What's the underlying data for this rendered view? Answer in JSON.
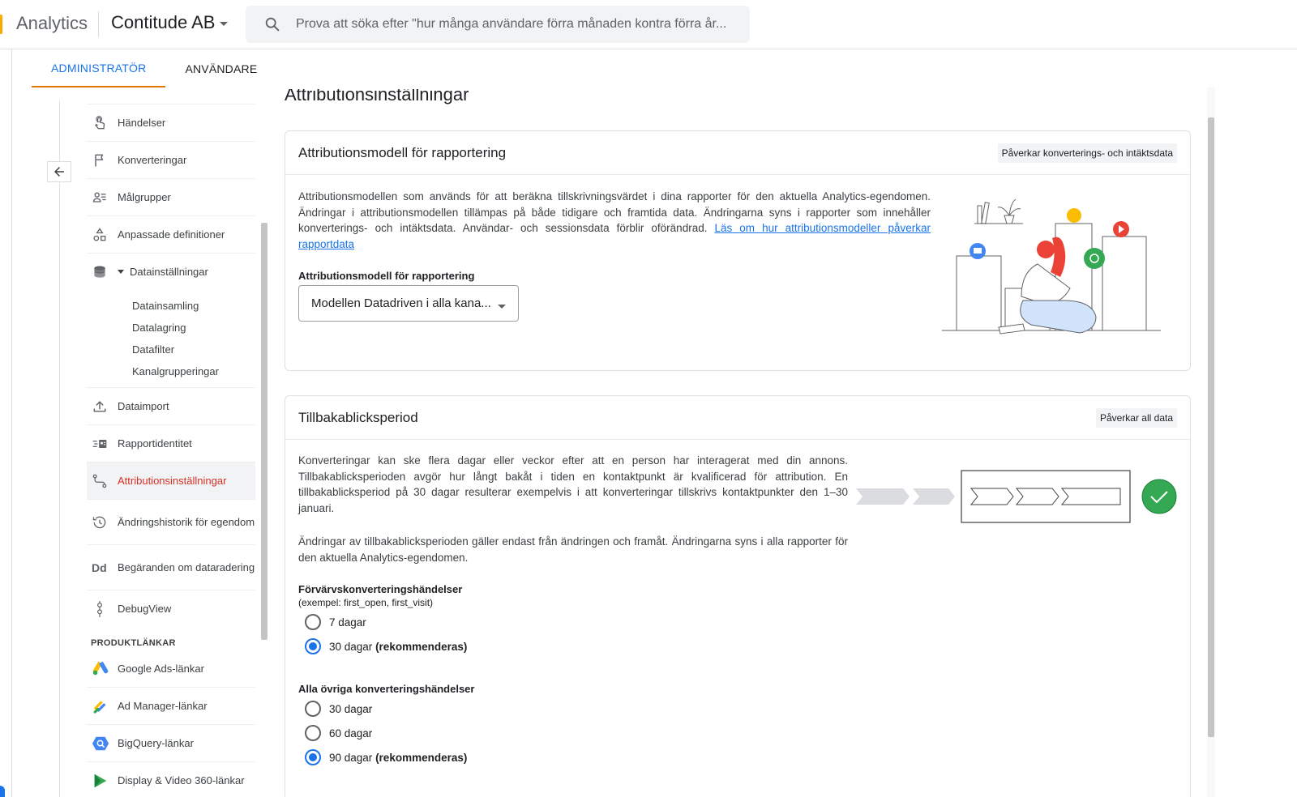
{
  "header": {
    "app_name": "Analytics",
    "account_name": "Contitude AB",
    "search_placeholder": "Prova att söka efter \"hur många användare förra månaden kontra förra år..."
  },
  "tabs": [
    {
      "label": "ADMINISTRATÖR",
      "active": true
    },
    {
      "label": "ANVÄNDARE",
      "active": false
    }
  ],
  "sidebar": {
    "items_top": [
      {
        "label": "Händelser",
        "icon": "touch-icon"
      },
      {
        "label": "Konverteringar",
        "icon": "flag-icon"
      },
      {
        "label": "Målgrupper",
        "icon": "audience-icon"
      },
      {
        "label": "Anpassade definitioner",
        "icon": "shapes-icon"
      }
    ],
    "data_settings": {
      "label": "Datainställningar",
      "icon": "database-icon",
      "sub_items": [
        "Datainsamling",
        "Datalagring",
        "Datafilter",
        "Kanalgrupperingar"
      ]
    },
    "items_bottom": [
      {
        "label": "Dataimport",
        "icon": "upload-icon"
      },
      {
        "label": "Rapportidentitet",
        "icon": "report-identity-icon"
      },
      {
        "label": "Attributionsinställningar",
        "icon": "attribution-icon",
        "active": true
      },
      {
        "label": "Ändringshistorik för egendom",
        "icon": "history-icon"
      },
      {
        "label": "Begäranden om dataradering",
        "icon": "dd-icon"
      },
      {
        "label": "DebugView",
        "icon": "debug-icon"
      }
    ],
    "product_links_label": "PRODUKTLÄNKAR",
    "product_links": [
      {
        "label": "Google Ads-länkar",
        "icon": "google-ads-icon"
      },
      {
        "label": "Ad Manager-länkar",
        "icon": "ad-manager-icon"
      },
      {
        "label": "BigQuery-länkar",
        "icon": "bigquery-icon"
      },
      {
        "label": "Display & Video 360-länkar",
        "icon": "display-video-icon"
      }
    ]
  },
  "main": {
    "page_title": "Attributionsinställningar",
    "card_model": {
      "title": "Attributionsmodell för rapportering",
      "chip": "Påverkar konverterings- och intäktsdata",
      "description": "Attributionsmodellen som används för att beräkna tillskrivningsvärdet i dina rapporter för den aktuella Analytics-egendomen. Ändringar i attributionsmodellen tillämpas på både tidigare och framtida data. Ändringarna syns i rapporter som innehåller konverterings- och intäktsdata. Användar- och sessionsdata förblir oförändrad.",
      "link": "Läs om hur attributionsmodeller påverkar rapportdata",
      "field_label": "Attributionsmodell för rapportering",
      "select_value": "Modellen Datadriven i alla kana..."
    },
    "card_lookback": {
      "title": "Tillbakablicksperiod",
      "chip": "Påverkar all data",
      "paragraph1": "Konverteringar kan ske flera dagar eller veckor efter att en person har interagerat med din annons. Tillbakablicksperioden avgör hur långt bakåt i tiden en kontaktpunkt är kvalificerad för attribution. En tillbakablicksperiod på 30 dagar resulterar exempelvis i att konverteringar tillskrivs kontaktpunkter den 1–30 januari.",
      "paragraph2": "Ändringar av tillbakablicksperioden gäller endast från ändringen och framåt. Ändringarna syns i alla rapporter för den aktuella Analytics-egendomen.",
      "acquisition_label": "Förvärvskonverteringshändelser",
      "acquisition_example": "(exempel: first_open, first_visit)",
      "acquisition_options": [
        {
          "label": "7 dagar",
          "suffix": "",
          "selected": false
        },
        {
          "label": "30 dagar",
          "suffix": "(rekommenderas)",
          "selected": true
        }
      ],
      "other_label": "Alla övriga konverteringshändelser",
      "other_options": [
        {
          "label": "30 dagar",
          "suffix": "",
          "selected": false
        },
        {
          "label": "60 dagar",
          "suffix": "",
          "selected": false
        },
        {
          "label": "90 dagar",
          "suffix": "(rekommenderas)",
          "selected": true
        }
      ]
    }
  },
  "colors": {
    "accent_blue": "#1a73e8",
    "active_red": "#d93025",
    "tab_underline": "#e37400",
    "success_green": "#34a853"
  }
}
